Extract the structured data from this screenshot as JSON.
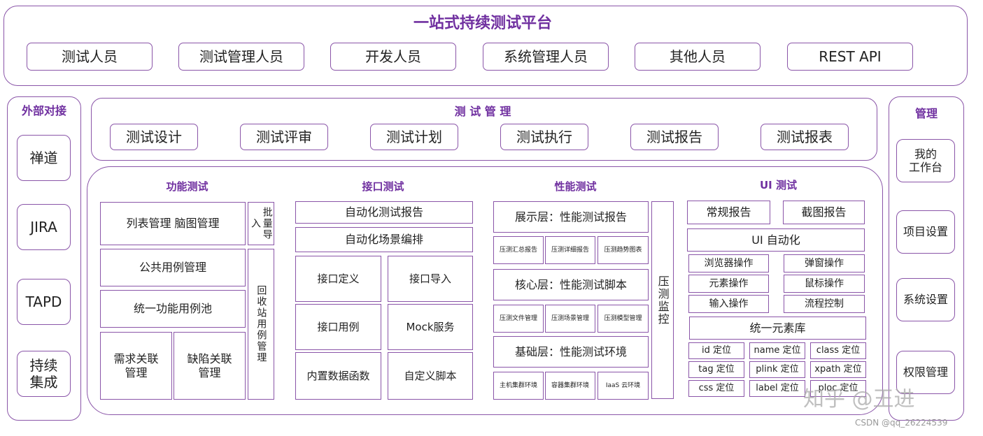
{
  "platform": {
    "title": "一站式持续测试平台",
    "roles": [
      "测试人员",
      "测试管理人员",
      "开发人员",
      "系统管理人员",
      "其他人员",
      "REST API"
    ]
  },
  "external": {
    "title": "外部对接",
    "items": [
      "禅道",
      "JIRA",
      "TAPD",
      "持续\n集成"
    ]
  },
  "test_management": {
    "title": "测 试 管 理",
    "items": [
      "测试设计",
      "测试评审",
      "测试计划",
      "测试执行",
      "测试报告",
      "测试报表"
    ]
  },
  "functional": {
    "title": "功能测试",
    "list_mindmap": "列表管理 脑图管理",
    "public_cases": "公共用例管理",
    "unified_pool": "统一功能用例池",
    "req_link": "需求关联\n管理",
    "defect_link": "缺陷关联\n管理",
    "batch_import": "批量导入",
    "recycle_bin": "回收站用例管理"
  },
  "interface": {
    "title": "接口测试",
    "report": "自动化测试报告",
    "scenario": "自动化场景编排",
    "cells": [
      "接口定义",
      "接口导入",
      "接口用例",
      "Mock服务",
      "内置数据函数",
      "自定义脚本"
    ]
  },
  "performance": {
    "title": "性能测试",
    "display_layer": "展示层：性能测试报告",
    "display_items": [
      "压测汇总报告",
      "压测详细报告",
      "压测趋势图表"
    ],
    "core_layer": "核心层：性能测试脚本",
    "core_items": [
      "压测文件管理",
      "压测场景管理",
      "压测模型管理"
    ],
    "base_layer": "基础层：性能测试环境",
    "base_items": [
      "主机集群环境",
      "容器集群环境",
      "IaaS 云环境"
    ],
    "monitor": "压测监控"
  },
  "ui_test": {
    "title": "UI 测试",
    "regular_report": "常规报告",
    "screenshot_report": "截图报告",
    "automation": "UI 自动化",
    "ops": [
      "浏览器操作",
      "弹窗操作",
      "元素操作",
      "鼠标操作",
      "输入操作",
      "流程控制"
    ],
    "element_lib": "统一元素库",
    "locators": [
      "id 定位",
      "name 定位",
      "class 定位",
      "tag 定位",
      "plink 定位",
      "xpath 定位",
      "css 定位",
      "label 定位",
      "ploc 定位"
    ]
  },
  "management": {
    "title": "管理",
    "items": [
      "我的\n工作台",
      "项目设置",
      "系统设置",
      "权限管理"
    ]
  },
  "watermark": {
    "zhihu": "知乎 @王进",
    "csdn": "CSDN @qq_26224539"
  }
}
